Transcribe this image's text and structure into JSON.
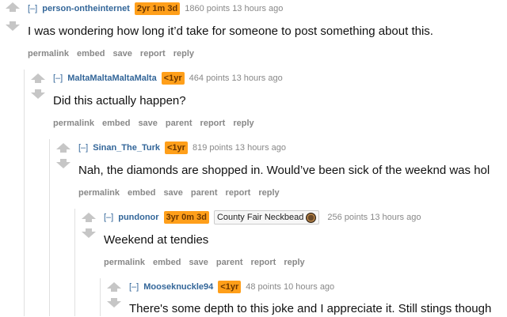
{
  "comments": [
    {
      "collapse": "[–]",
      "author": "person-ontheinternet",
      "age": "2yr 1m 3d",
      "score": "1860 points",
      "time": "13 hours ago",
      "body": "I was wondering how long it’d take for someone to post something about this.",
      "buttons": [
        "permalink",
        "embed",
        "save",
        "report",
        "reply"
      ]
    },
    {
      "collapse": "[–]",
      "author": "MaltaMaltaMaltaMalta",
      "age": "<1yr",
      "score": "464 points",
      "time": "13 hours ago",
      "body": "Did this actually happen?",
      "buttons": [
        "permalink",
        "embed",
        "save",
        "parent",
        "report",
        "reply"
      ]
    },
    {
      "collapse": "[–]",
      "author": "Sinan_The_Turk",
      "age": "<1yr",
      "score": "819 points",
      "time": "13 hours ago",
      "body": "Nah, the diamonds are shopped in. Would’ve been sick of the weeknd was hol",
      "buttons": [
        "permalink",
        "embed",
        "save",
        "parent",
        "report",
        "reply"
      ]
    },
    {
      "collapse": "[–]",
      "author": "pundonor",
      "age": "3yr 0m 3d",
      "flair": "County Fair Neckbead",
      "flair_icon": "neckbeard-face-icon",
      "score": "256 points",
      "time": "13 hours ago",
      "body": "Weekend at tendies",
      "buttons": [
        "permalink",
        "embed",
        "save",
        "parent",
        "report",
        "reply"
      ]
    },
    {
      "collapse": "[–]",
      "author": "Mooseknuckle94",
      "age": "<1yr",
      "score": "48 points",
      "time": "10 hours ago",
      "body": "There's some depth to this joke and I appreciate it. Still stings though",
      "buttons": []
    }
  ],
  "colors": {
    "author": "#336699",
    "age_badge": "#ff9f1a",
    "arrow": "#c6c6c6",
    "muted": "#888888"
  }
}
